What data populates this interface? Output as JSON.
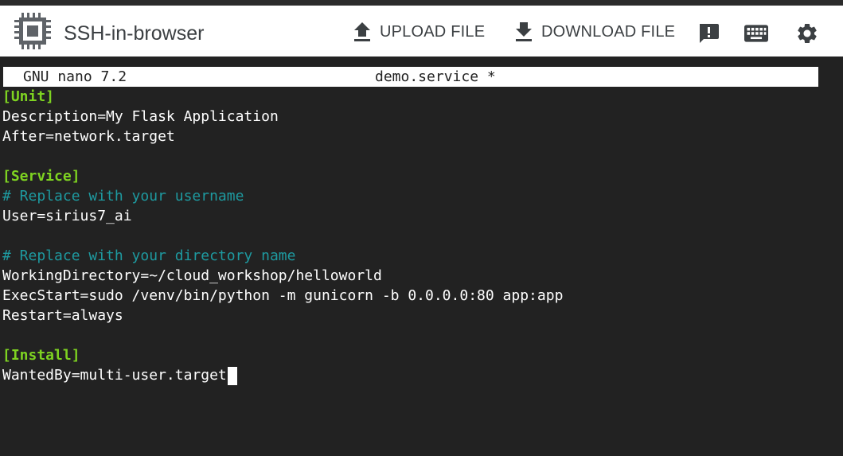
{
  "app": {
    "title": "SSH-in-browser",
    "logo_icon": "chip-icon"
  },
  "toolbar": {
    "upload_label": "UPLOAD FILE",
    "upload_icon": "upload-icon",
    "download_label": "DOWNLOAD FILE",
    "download_icon": "download-icon",
    "feedback_icon": "feedback-icon",
    "keyboard_icon": "keyboard-icon",
    "settings_icon": "gear-icon"
  },
  "colors": {
    "section": "#7ed321",
    "comment": "#1e9aa0",
    "terminal_bg": "#222222",
    "text": "#ffffff"
  },
  "nano": {
    "version": "GNU nano 7.2",
    "filename": "demo.service *"
  },
  "lines": [
    "[Unit]",
    "Description=My Flask Application",
    "After=network.target",
    "",
    "[Service]",
    "# Replace with your username",
    "User=sirius7_ai",
    "",
    "# Replace with your directory name",
    "WorkingDirectory=~/cloud_workshop/helloworld",
    "ExecStart=sudo /venv/bin/python -m gunicorn -b 0.0.0.0:80 app:app",
    "Restart=always",
    "",
    "[Install]",
    "WantedBy=multi-user.target"
  ]
}
